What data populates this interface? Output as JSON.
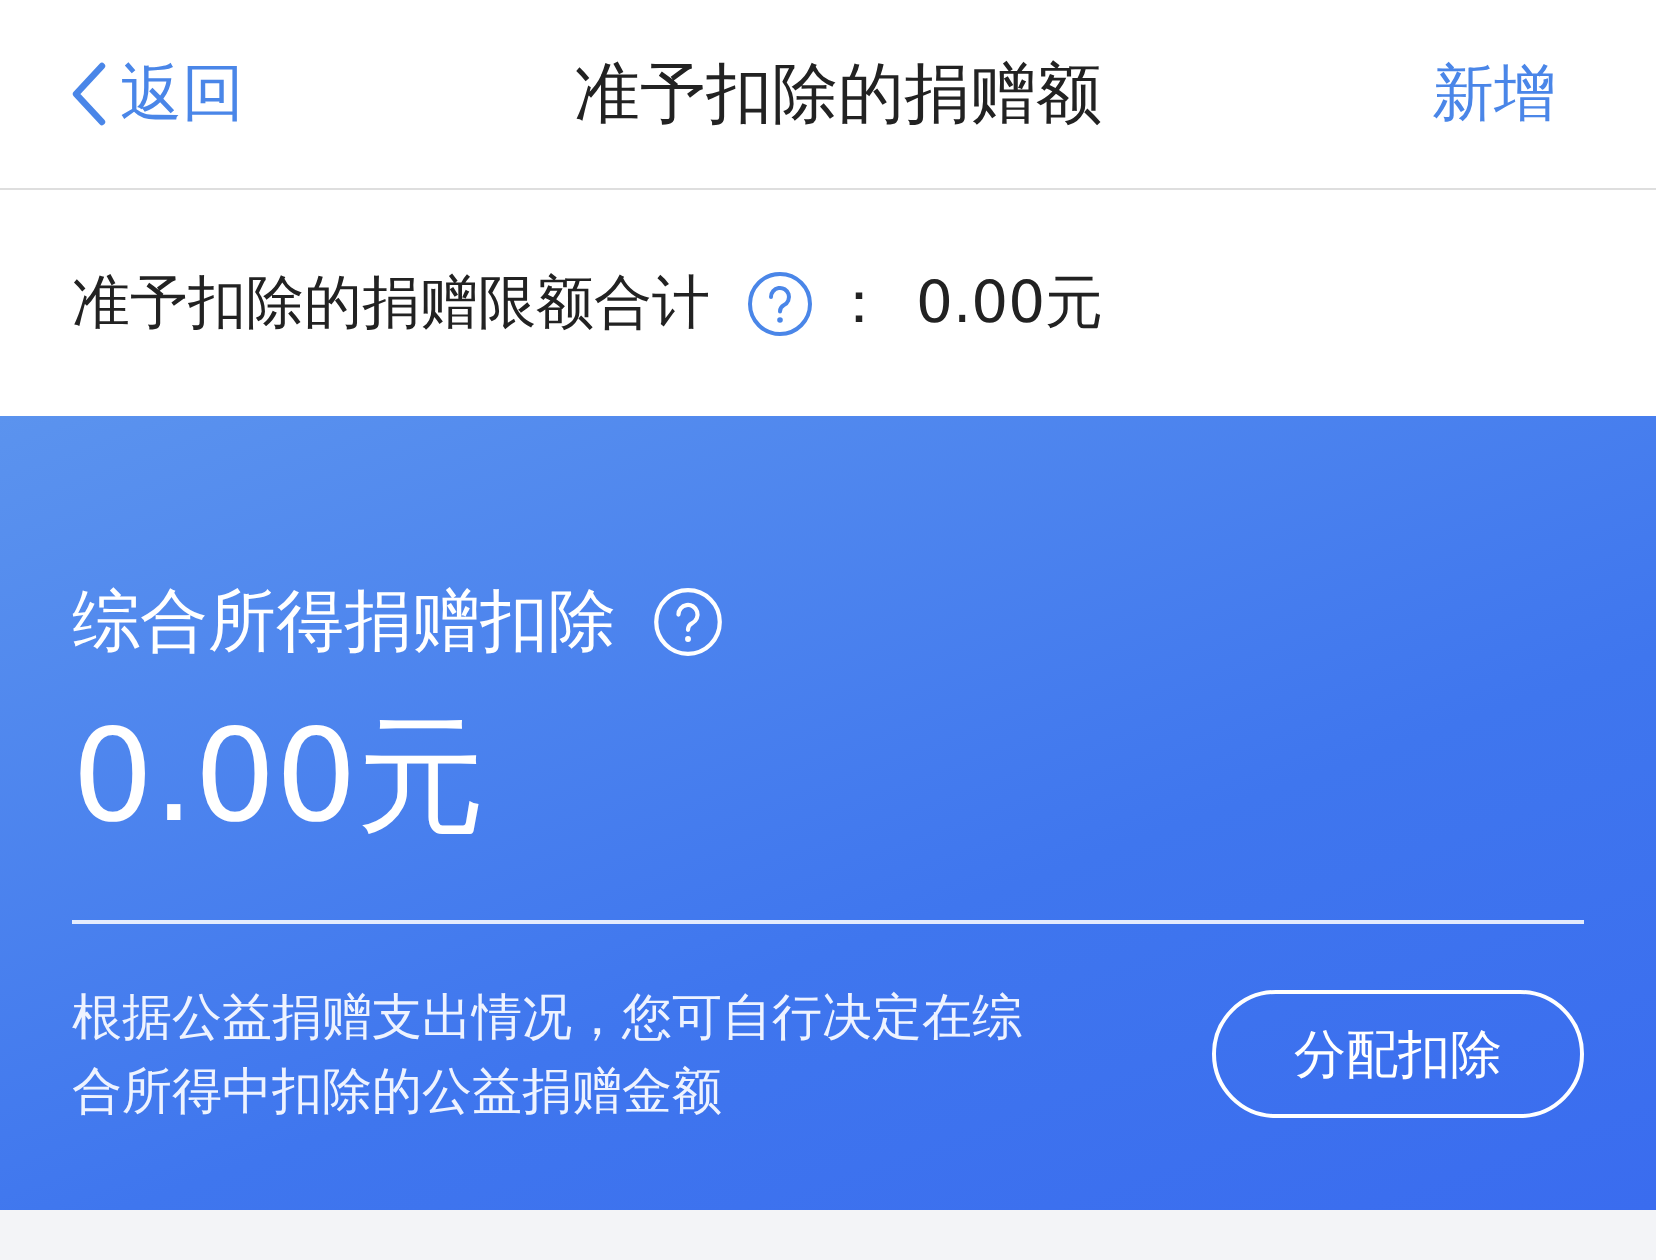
{
  "nav": {
    "back": "返回",
    "title": "准予扣除的捐赠额",
    "action": "新增"
  },
  "limit_row": {
    "label": "准予扣除的捐赠限额合计",
    "separator": "：",
    "value": "0.00元"
  },
  "card": {
    "title": "综合所得捐赠扣除",
    "amount": "0.00元",
    "description": "根据公益捐赠支出情况，您可自行决定在综合所得中扣除的公益捐赠金额",
    "button": "分配扣除"
  }
}
